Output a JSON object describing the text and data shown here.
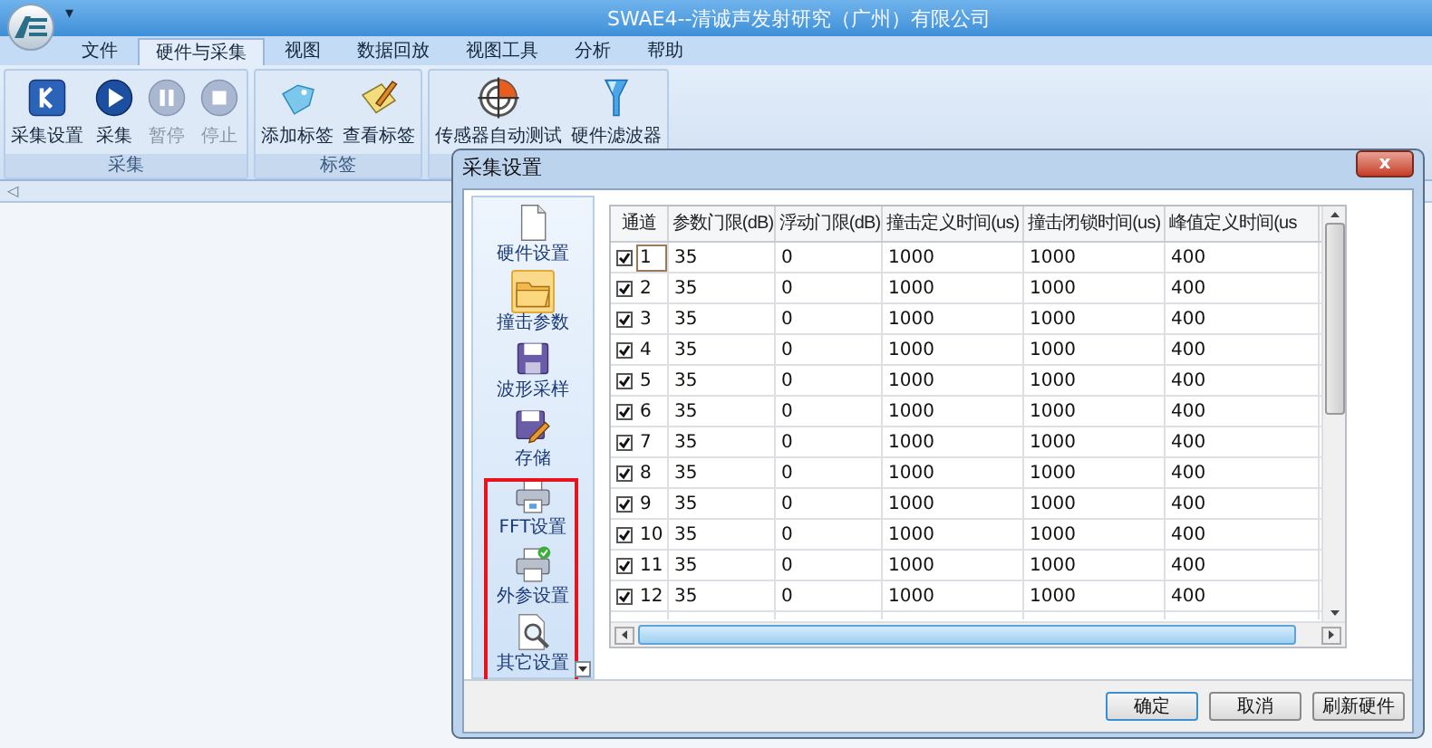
{
  "window": {
    "title": "SWAE4--清诚声发射研究（广州）有限公司",
    "quick_access": "▾"
  },
  "tabs": [
    {
      "label": "文件",
      "selected": false
    },
    {
      "label": "硬件与采集",
      "selected": true
    },
    {
      "label": "视图",
      "selected": false
    },
    {
      "label": "数据回放",
      "selected": false
    },
    {
      "label": "视图工具",
      "selected": false
    },
    {
      "label": "分析",
      "selected": false
    },
    {
      "label": "帮助",
      "selected": false
    }
  ],
  "ribbon_groups": [
    {
      "label": "采集",
      "buttons": [
        {
          "label": "采集设置",
          "kind": "settings",
          "disabled": false
        },
        {
          "label": "采集",
          "kind": "play",
          "disabled": false
        },
        {
          "label": "暂停",
          "kind": "pause",
          "disabled": true
        },
        {
          "label": "停止",
          "kind": "stop",
          "disabled": true
        }
      ]
    },
    {
      "label": "标签",
      "buttons": [
        {
          "label": "添加标签",
          "kind": "tag",
          "disabled": false
        },
        {
          "label": "查看标签",
          "kind": "note",
          "disabled": false
        }
      ]
    },
    {
      "buttons": [
        {
          "label": "传感器自动测试",
          "kind": "target",
          "disabled": false
        },
        {
          "label": "硬件滤波器",
          "kind": "funnel",
          "disabled": false
        }
      ]
    }
  ],
  "panel_bar": {
    "collapse": "◁"
  },
  "dialog": {
    "title": "采集设置",
    "close": "x",
    "nav": [
      {
        "label": "硬件设置",
        "kind": "page",
        "selected": false
      },
      {
        "label": "撞击参数",
        "kind": "folder",
        "selected": true
      },
      {
        "label": "波形采样",
        "kind": "disk",
        "selected": false
      },
      {
        "label": "存储",
        "kind": "disk-edit",
        "selected": false
      },
      {
        "label": "FFT设置",
        "kind": "printer",
        "selected": false
      },
      {
        "label": "外参设置",
        "kind": "printer-check",
        "selected": false
      },
      {
        "label": "其它设置",
        "kind": "magnifier",
        "selected": false
      }
    ],
    "table": {
      "columns": [
        "通道",
        "参数门限(dB)",
        "浮动门限(dB)",
        "撞击定义时间(us)",
        "撞击闭锁时间(us)",
        "峰值定义时间(us"
      ],
      "rows": [
        {
          "checked": true,
          "focused": true,
          "cells": [
            "1",
            "35",
            "0",
            "1000",
            "1000",
            "400"
          ]
        },
        {
          "checked": true,
          "focused": false,
          "cells": [
            "2",
            "35",
            "0",
            "1000",
            "1000",
            "400"
          ]
        },
        {
          "checked": true,
          "focused": false,
          "cells": [
            "3",
            "35",
            "0",
            "1000",
            "1000",
            "400"
          ]
        },
        {
          "checked": true,
          "focused": false,
          "cells": [
            "4",
            "35",
            "0",
            "1000",
            "1000",
            "400"
          ]
        },
        {
          "checked": true,
          "focused": false,
          "cells": [
            "5",
            "35",
            "0",
            "1000",
            "1000",
            "400"
          ]
        },
        {
          "checked": true,
          "focused": false,
          "cells": [
            "6",
            "35",
            "0",
            "1000",
            "1000",
            "400"
          ]
        },
        {
          "checked": true,
          "focused": false,
          "cells": [
            "7",
            "35",
            "0",
            "1000",
            "1000",
            "400"
          ]
        },
        {
          "checked": true,
          "focused": false,
          "cells": [
            "8",
            "35",
            "0",
            "1000",
            "1000",
            "400"
          ]
        },
        {
          "checked": true,
          "focused": false,
          "cells": [
            "9",
            "35",
            "0",
            "1000",
            "1000",
            "400"
          ]
        },
        {
          "checked": true,
          "focused": false,
          "cells": [
            "10",
            "35",
            "0",
            "1000",
            "1000",
            "400"
          ]
        },
        {
          "checked": true,
          "focused": false,
          "cells": [
            "11",
            "35",
            "0",
            "1000",
            "1000",
            "400"
          ]
        },
        {
          "checked": true,
          "focused": false,
          "cells": [
            "12",
            "35",
            "0",
            "1000",
            "1000",
            "400"
          ]
        }
      ]
    },
    "buttons": [
      {
        "label": "确定",
        "default": true
      },
      {
        "label": "取消",
        "default": false
      },
      {
        "label": "刷新硬件",
        "default": false
      }
    ]
  }
}
